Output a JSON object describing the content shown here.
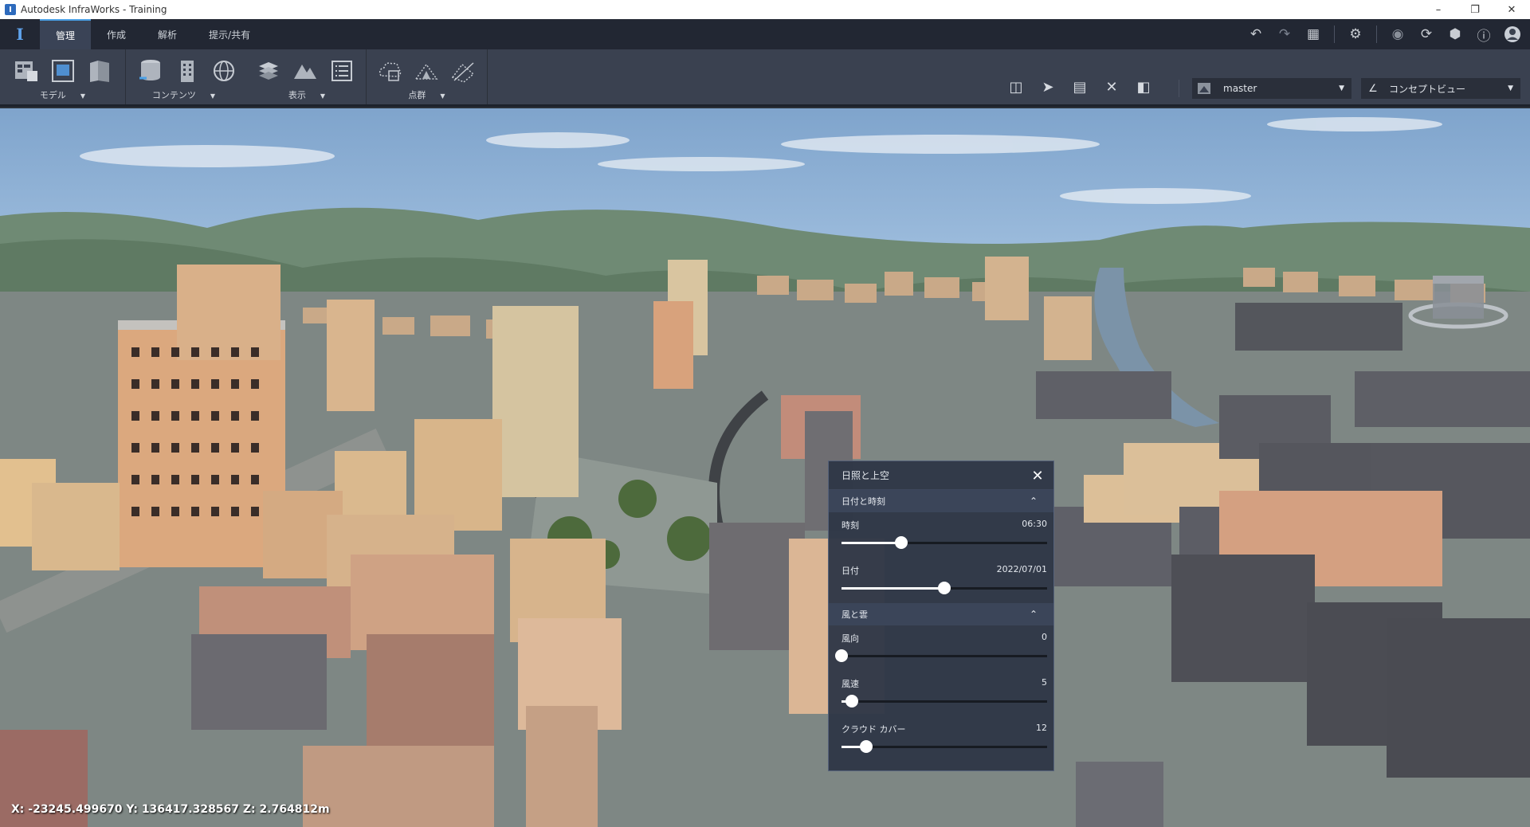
{
  "window": {
    "title": "Autodesk InfraWorks - Training",
    "app_icon": "I"
  },
  "tabs": [
    {
      "label": "管理",
      "active": true
    },
    {
      "label": "作成",
      "active": false
    },
    {
      "label": "解析",
      "active": false
    },
    {
      "label": "提示/共有",
      "active": false
    }
  ],
  "ribbon": {
    "groups": [
      {
        "label": "モデル"
      },
      {
        "label": "コンテンツ"
      },
      {
        "label": "表示"
      },
      {
        "label": "点群"
      }
    ],
    "proposal_dropdown": "master",
    "view_dropdown": "コンセプトビュー"
  },
  "viewport": {
    "coordinates": "X: -23245.499670 Y: 136417.328567 Z: 2.764812m"
  },
  "sun_sky_panel": {
    "title": "日照と上空",
    "sections": [
      {
        "header": "日付と時刻",
        "rows": [
          {
            "label": "時刻",
            "value": "06:30",
            "level": 0.29
          },
          {
            "label": "日付",
            "value": "2022/07/01",
            "level": 0.5
          }
        ]
      },
      {
        "header": "風と雲",
        "rows": [
          {
            "label": "風向",
            "value": "0",
            "level": 0.0
          },
          {
            "label": "風速",
            "value": "5",
            "level": 0.05
          },
          {
            "label": "クラウド カバー",
            "value": "12",
            "level": 0.12
          }
        ]
      }
    ]
  },
  "colors": {
    "accent": "#4aa0e6",
    "panel_bg": "#2f3747",
    "ribbon_bg": "#3a4150"
  }
}
